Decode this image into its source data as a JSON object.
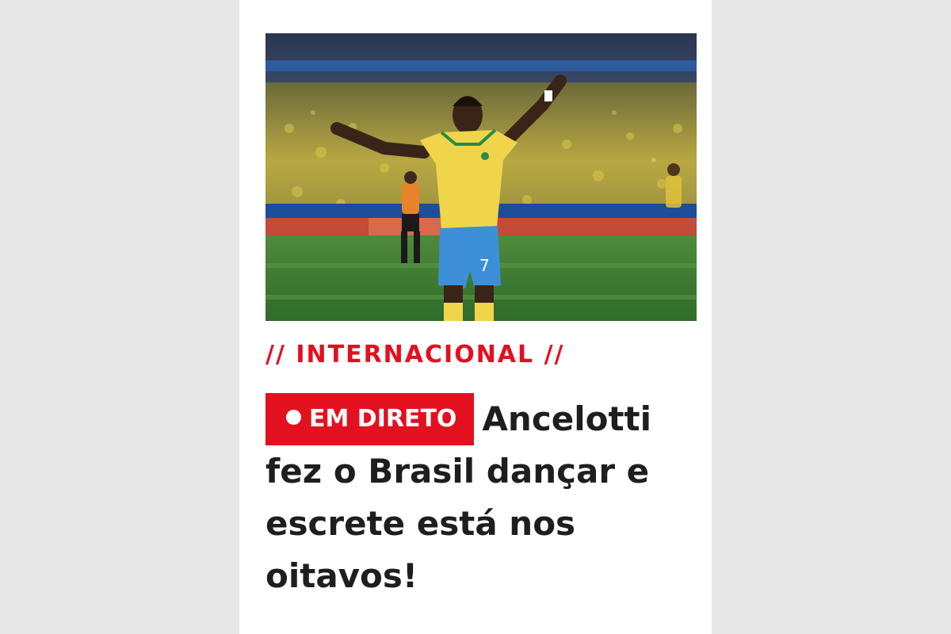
{
  "article": {
    "image_alt": "Jogador do Brasil a celebrar no estádio",
    "category": "// INTERNACIONAL //",
    "live_badge": "EM DIRETO",
    "headline": "Ancelotti fez o Brasil dançar e escrete está nos oitavos!"
  },
  "colors": {
    "accent": "#e3101f",
    "text": "#1e1e1e",
    "background": "#e8e8e8",
    "card": "#ffffff"
  }
}
